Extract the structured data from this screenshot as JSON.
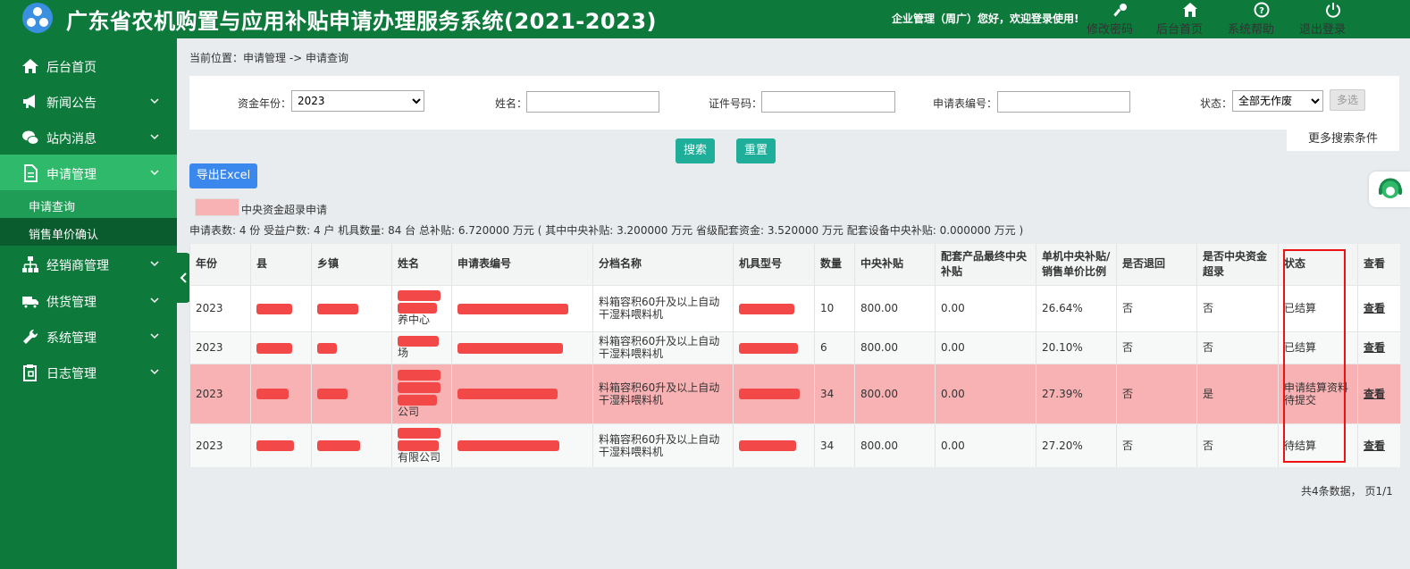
{
  "header": {
    "title": "广东省农机购置与应用补贴申请办理服务系统(2021-2023)",
    "welcome": "企业管理（周广）您好，欢迎登录使用!",
    "nav": [
      {
        "label": "修改密码",
        "icon": "key-icon"
      },
      {
        "label": "后台首页",
        "icon": "home-icon"
      },
      {
        "label": "系统帮助",
        "icon": "help-icon"
      },
      {
        "label": "退出登录",
        "icon": "power-icon"
      }
    ]
  },
  "sidebar": {
    "items": [
      {
        "label": "后台首页",
        "icon": "home-icon"
      },
      {
        "label": "新闻公告",
        "icon": "megaphone-icon"
      },
      {
        "label": "站内消息",
        "icon": "chat-icon"
      },
      {
        "label": "申请管理",
        "icon": "document-icon"
      },
      {
        "label": "经销商管理",
        "icon": "org-chart-icon"
      },
      {
        "label": "供货管理",
        "icon": "truck-icon"
      },
      {
        "label": "系统管理",
        "icon": "wrench-icon"
      },
      {
        "label": "日志管理",
        "icon": "clipboard-icon"
      }
    ],
    "sub_items": [
      "申请查询",
      "销售单价确认"
    ]
  },
  "breadcrumb": "当前位置：申请管理 -> 申请查询",
  "search": {
    "year_label": "资金年份：",
    "year_value": "2023",
    "name_label": "姓名：",
    "name_value": "",
    "id_label": "证件号码：",
    "id_value": "",
    "form_no_label": "申请表编号：",
    "form_no_value": "",
    "status_label": "状态：",
    "status_value": "全部无作废",
    "multi_label": "多选",
    "more_label": "更多搜索条件",
    "search_btn": "搜索",
    "reset_btn": "重置",
    "export_btn": "导出Excel"
  },
  "legend_text": "中央资金超录申请",
  "summary": "申请表数: 4 份  受益户数: 4 户  机具数量: 84 台  总补贴: 6.720000 万元 ( 其中中央补贴: 3.200000 万元    省级配套资金: 3.520000 万元    配套设备中央补贴: 0.000000 万元  )",
  "table": {
    "headers": [
      "年份",
      "县",
      "乡镇",
      "姓名",
      "申请表编号",
      "分档名称",
      "机具型号",
      "数量",
      "中央补贴",
      "配套产品最终中央补贴",
      "单机中央补贴/销售单价比例",
      "是否退回",
      "是否中央资金超录",
      "状态",
      "查看"
    ],
    "rows": [
      {
        "year": "2023",
        "name_tail": "养中心",
        "category": "料箱容积60升及以上自动干湿料喂料机",
        "qty": "10",
        "subsidy": "800.00",
        "matching": "0.00",
        "ratio": "26.64%",
        "returned": "否",
        "over": "否",
        "status": "已结算",
        "view": "查看"
      },
      {
        "year": "2023",
        "name_tail": "场",
        "category": "料箱容积60升及以上自动干湿料喂料机",
        "qty": "6",
        "subsidy": "800.00",
        "matching": "0.00",
        "ratio": "20.10%",
        "returned": "否",
        "over": "否",
        "status": "已结算",
        "view": "查看"
      },
      {
        "year": "2023",
        "name_tail": "公司",
        "category": "料箱容积60升及以上自动干湿料喂料机",
        "qty": "34",
        "subsidy": "800.00",
        "matching": "0.00",
        "ratio": "27.39%",
        "returned": "否",
        "over": "是",
        "status": "申请结算资料待提交",
        "view": "查看"
      },
      {
        "year": "2023",
        "name_tail": "有限公司",
        "category": "料箱容积60升及以上自动干湿料喂料机",
        "qty": "34",
        "subsidy": "800.00",
        "matching": "0.00",
        "ratio": "27.20%",
        "returned": "否",
        "over": "否",
        "status": "待结算",
        "view": "查看"
      }
    ]
  },
  "pager": "共4条数据，  页1/1",
  "colors": {
    "green": "#0d7a3c",
    "active": "#2fb96b",
    "teal": "#1fae9a",
    "blue": "#3a88ee",
    "pink": "#f8b2b4",
    "redact": "#f24848"
  }
}
